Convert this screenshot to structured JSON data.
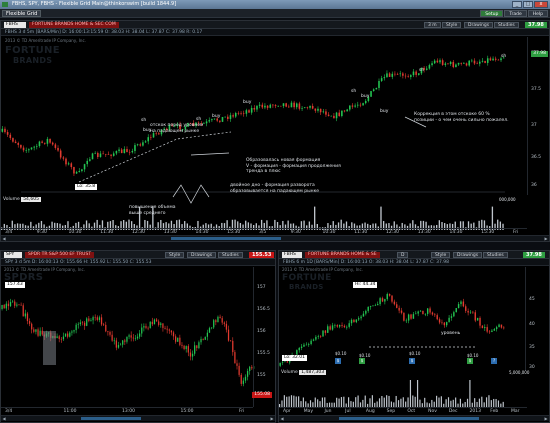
{
  "window": {
    "title": "FBHS, SPY, FBHS - Flexible Grid Main@thinkorswim [build 1844.9]",
    "min": "_",
    "max": "□",
    "close": "x"
  },
  "menubar": {
    "grid_tab": "Flexible Grid",
    "setup": "Setup",
    "trade": "Trade",
    "help": "Help"
  },
  "top": {
    "symbol": "FBHS",
    "desc": "FORTUNE BRANDS HOME & SEC COM",
    "period_btn": "3 m",
    "style": "Style",
    "drawings": "Drawings",
    "studies": "Studies",
    "last": "37.98",
    "quote": "FBHS 3 d 5m [BARS/Min]   D: 16:00:13:15:59   O: 38.03   H: 38.04   L: 37.87   C: 37.98   R: 0.17",
    "copyright": "2013 © TD Ameritrade IP Company, Inc.",
    "wm_top": "FORTUNE",
    "wm_bottom": "BRANDS",
    "lo_tag": "Lo: 35.8",
    "price_tag": "37.98",
    "yticks": [
      "38",
      "37.5",
      "37",
      "36.5",
      "36"
    ],
    "xticks": [
      "3/4",
      "9:30",
      "10:30",
      "11:30",
      "12:30",
      "13:30",
      "14:30",
      "15:30",
      "3/5",
      "9:30",
      "10:30",
      "11:30",
      "12:30",
      "13:30",
      "14:30",
      "15:30",
      "Fri"
    ],
    "ann_shop": "отскок перед уровнем\nна падающем рынке",
    "ann_v": "Образовалась новая формация\nV - формация - формация продолжения\nтренда в плюс",
    "ann_dd": "двойное дно - формация разворота\nобразовывается на падающем рынке",
    "ann_kor": "Коррекция в этом отскоке 60 %\nпозиции - о чем очень сильно пожалел.",
    "sig_sh": "sh",
    "sig_buy": "buy",
    "sig_sh2": "sh",
    "sig_buy2": "buy",
    "sig_buy3": "buy",
    "sig_buy4": "buy",
    "sig_sh3": "sh",
    "sig_sh4": "sh",
    "sig_sh5": "sh",
    "sig_buy5": "buy",
    "volume_label": "Volume",
    "volume_value": "54,605",
    "vol_ann": "повышение объема\nвыше среднего",
    "vol_tick_r": "000,000"
  },
  "spy": {
    "symbol": "SPY",
    "desc": "SPDR TR S&P 500 EF TRUST",
    "style": "Style",
    "drawings": "Drawings",
    "studies": "Studies",
    "last": "155.53",
    "quote": "SPY 3 d 5m   D: 16:00:13   O: 155.66   H: 155.92   L: 155.50   C: 155.53",
    "copyright": "2013 © TD Ameritrade IP Company, Inc.",
    "wm": "SPDRS",
    "hi_tag": "157.43",
    "lo_tag": "155.08",
    "yticks": [
      "157",
      "156.5",
      "156",
      "155.5",
      "155",
      "154.5"
    ],
    "xticks": [
      "3/4",
      "11:00",
      "13:00",
      "15:00",
      "Fri"
    ]
  },
  "fb2": {
    "symbol": "FBHS",
    "desc": "FORTUNE BRANDS HOME & SE",
    "period_btn": "D",
    "style": "Style",
    "drawings": "Drawings",
    "studies": "Studies",
    "last": "37.98",
    "quote": "FBHS 6 m 1D [BARS/Min]   D: 16:00:13   O: 38.03   H: 38.04   L: 37.87   C: 37.98",
    "copyright": "2013 © TD Ameritrade IP Company, Inc.",
    "wm_top": "FORTUNE",
    "wm_bottom": "BRANDS",
    "hi_tag": "Hi: 44.34",
    "lo_tag": "Lo: 32.01",
    "level_label": "уровень",
    "yticks": [
      "45",
      "40",
      "35",
      "30"
    ],
    "xticks": [
      "Apr",
      "May",
      "Jun",
      "Jul",
      "Aug",
      "Sep",
      "Oct",
      "Nov",
      "Dec",
      "2013",
      "Feb",
      "Mar"
    ],
    "events": [
      "$0.10",
      "$0.10",
      "$0.10",
      "$0.10"
    ],
    "volume_label": "Volume",
    "volume_value": "1,487,303",
    "vol_tick_r": "5,000,000"
  },
  "colors": {
    "up": "#23c552",
    "down": "#e23a2f",
    "accent": "#c81616",
    "fg": "#c8ccd0"
  }
}
